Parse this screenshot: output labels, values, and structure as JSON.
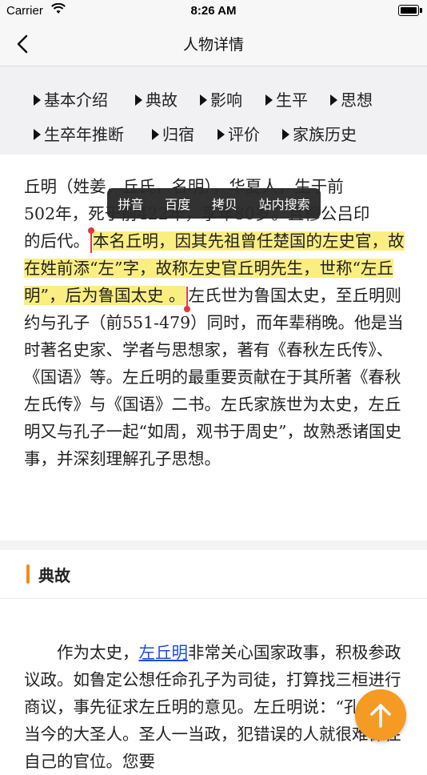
{
  "status_bar": {
    "carrier": "Carrier",
    "time": "8:26 AM"
  },
  "nav": {
    "title": "人物详情",
    "back_icon": "chevron-left-icon"
  },
  "sections": [
    {
      "label": "基本介绍"
    },
    {
      "label": "典故"
    },
    {
      "label": "影响"
    },
    {
      "label": "生平"
    },
    {
      "label": "思想"
    },
    {
      "label": "生卒年推断"
    },
    {
      "label": "归宿"
    },
    {
      "label": "评价"
    },
    {
      "label": "家族历史"
    }
  ],
  "context_menu": {
    "items": [
      "拼音",
      "百度",
      "拷贝",
      "站内搜索"
    ]
  },
  "intro": {
    "line1": "丘明（姓姜，丘氏，名明），华夏人，生于前",
    "line2": "502年，死于前422年，享年80岁。且穆公吕印",
    "line3_pre": "的后代。",
    "highlight": "本名丘明，因其先祖曾任楚国的左史官，故在姓前添“左”字，故称左史官丘明先生，世称“左丘明”，后为鲁国太史 。",
    "rest": "左氏世为鲁国太史，至丘明则约与孔子（前551-479）同时，而年辈稍晚。他是当时著名史家、学者与思想家，著有《春秋左氏传》、《国语》等。左丘明的最重要贡献在于其所著《春秋左氏传》与《国语》二书。左氏家族世为太史，左丘明又与孔子一起“如周，观书于周史”，故熟悉诸国史事，并深刻理解孔子思想。"
  },
  "allusion_section": {
    "title": "典故"
  },
  "story": {
    "pre": "作为太史，",
    "link": "左丘明",
    "post": "非常关心国家政事，积极参政议政。如鲁定公想任命孔子为司徒，打算找三桓进行商议，事先征求左丘明的意见。左丘明说：“孔子是当今的大圣人。圣人一当政，犯错误的人就很难保住自己的官位。您要"
  },
  "fab": {
    "icon": "arrow-up-icon"
  },
  "colors": {
    "accent": "#f59a22",
    "highlight": "#faee81",
    "link": "#1a4fd6"
  }
}
